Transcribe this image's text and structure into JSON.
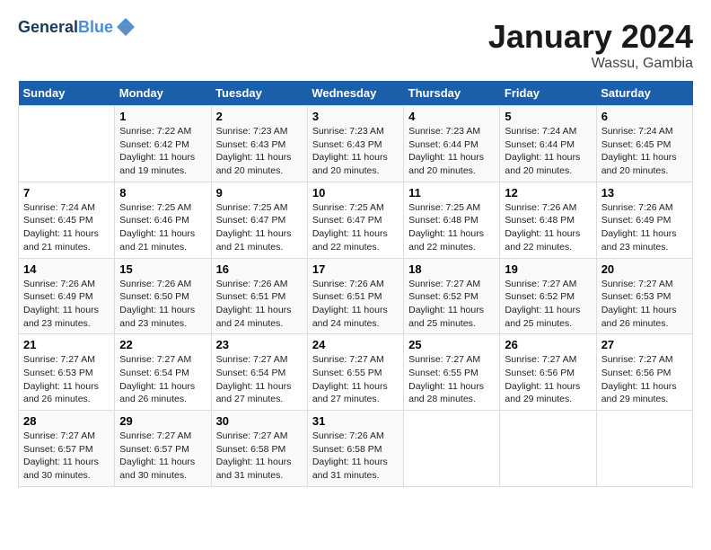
{
  "logo": {
    "line1": "General",
    "line2": "Blue"
  },
  "title": "January 2024",
  "subtitle": "Wassu, Gambia",
  "days_header": [
    "Sunday",
    "Monday",
    "Tuesday",
    "Wednesday",
    "Thursday",
    "Friday",
    "Saturday"
  ],
  "weeks": [
    [
      {
        "day": "",
        "content": ""
      },
      {
        "day": "1",
        "content": "Sunrise: 7:22 AM\nSunset: 6:42 PM\nDaylight: 11 hours\nand 19 minutes."
      },
      {
        "day": "2",
        "content": "Sunrise: 7:23 AM\nSunset: 6:43 PM\nDaylight: 11 hours\nand 20 minutes."
      },
      {
        "day": "3",
        "content": "Sunrise: 7:23 AM\nSunset: 6:43 PM\nDaylight: 11 hours\nand 20 minutes."
      },
      {
        "day": "4",
        "content": "Sunrise: 7:23 AM\nSunset: 6:44 PM\nDaylight: 11 hours\nand 20 minutes."
      },
      {
        "day": "5",
        "content": "Sunrise: 7:24 AM\nSunset: 6:44 PM\nDaylight: 11 hours\nand 20 minutes."
      },
      {
        "day": "6",
        "content": "Sunrise: 7:24 AM\nSunset: 6:45 PM\nDaylight: 11 hours\nand 20 minutes."
      }
    ],
    [
      {
        "day": "7",
        "content": "Sunrise: 7:24 AM\nSunset: 6:45 PM\nDaylight: 11 hours\nand 21 minutes."
      },
      {
        "day": "8",
        "content": "Sunrise: 7:25 AM\nSunset: 6:46 PM\nDaylight: 11 hours\nand 21 minutes."
      },
      {
        "day": "9",
        "content": "Sunrise: 7:25 AM\nSunset: 6:47 PM\nDaylight: 11 hours\nand 21 minutes."
      },
      {
        "day": "10",
        "content": "Sunrise: 7:25 AM\nSunset: 6:47 PM\nDaylight: 11 hours\nand 22 minutes."
      },
      {
        "day": "11",
        "content": "Sunrise: 7:25 AM\nSunset: 6:48 PM\nDaylight: 11 hours\nand 22 minutes."
      },
      {
        "day": "12",
        "content": "Sunrise: 7:26 AM\nSunset: 6:48 PM\nDaylight: 11 hours\nand 22 minutes."
      },
      {
        "day": "13",
        "content": "Sunrise: 7:26 AM\nSunset: 6:49 PM\nDaylight: 11 hours\nand 23 minutes."
      }
    ],
    [
      {
        "day": "14",
        "content": "Sunrise: 7:26 AM\nSunset: 6:49 PM\nDaylight: 11 hours\nand 23 minutes."
      },
      {
        "day": "15",
        "content": "Sunrise: 7:26 AM\nSunset: 6:50 PM\nDaylight: 11 hours\nand 23 minutes."
      },
      {
        "day": "16",
        "content": "Sunrise: 7:26 AM\nSunset: 6:51 PM\nDaylight: 11 hours\nand 24 minutes."
      },
      {
        "day": "17",
        "content": "Sunrise: 7:26 AM\nSunset: 6:51 PM\nDaylight: 11 hours\nand 24 minutes."
      },
      {
        "day": "18",
        "content": "Sunrise: 7:27 AM\nSunset: 6:52 PM\nDaylight: 11 hours\nand 25 minutes."
      },
      {
        "day": "19",
        "content": "Sunrise: 7:27 AM\nSunset: 6:52 PM\nDaylight: 11 hours\nand 25 minutes."
      },
      {
        "day": "20",
        "content": "Sunrise: 7:27 AM\nSunset: 6:53 PM\nDaylight: 11 hours\nand 26 minutes."
      }
    ],
    [
      {
        "day": "21",
        "content": "Sunrise: 7:27 AM\nSunset: 6:53 PM\nDaylight: 11 hours\nand 26 minutes."
      },
      {
        "day": "22",
        "content": "Sunrise: 7:27 AM\nSunset: 6:54 PM\nDaylight: 11 hours\nand 26 minutes."
      },
      {
        "day": "23",
        "content": "Sunrise: 7:27 AM\nSunset: 6:54 PM\nDaylight: 11 hours\nand 27 minutes."
      },
      {
        "day": "24",
        "content": "Sunrise: 7:27 AM\nSunset: 6:55 PM\nDaylight: 11 hours\nand 27 minutes."
      },
      {
        "day": "25",
        "content": "Sunrise: 7:27 AM\nSunset: 6:55 PM\nDaylight: 11 hours\nand 28 minutes."
      },
      {
        "day": "26",
        "content": "Sunrise: 7:27 AM\nSunset: 6:56 PM\nDaylight: 11 hours\nand 29 minutes."
      },
      {
        "day": "27",
        "content": "Sunrise: 7:27 AM\nSunset: 6:56 PM\nDaylight: 11 hours\nand 29 minutes."
      }
    ],
    [
      {
        "day": "28",
        "content": "Sunrise: 7:27 AM\nSunset: 6:57 PM\nDaylight: 11 hours\nand 30 minutes."
      },
      {
        "day": "29",
        "content": "Sunrise: 7:27 AM\nSunset: 6:57 PM\nDaylight: 11 hours\nand 30 minutes."
      },
      {
        "day": "30",
        "content": "Sunrise: 7:27 AM\nSunset: 6:58 PM\nDaylight: 11 hours\nand 31 minutes."
      },
      {
        "day": "31",
        "content": "Sunrise: 7:26 AM\nSunset: 6:58 PM\nDaylight: 11 hours\nand 31 minutes."
      },
      {
        "day": "",
        "content": ""
      },
      {
        "day": "",
        "content": ""
      },
      {
        "day": "",
        "content": ""
      }
    ]
  ]
}
